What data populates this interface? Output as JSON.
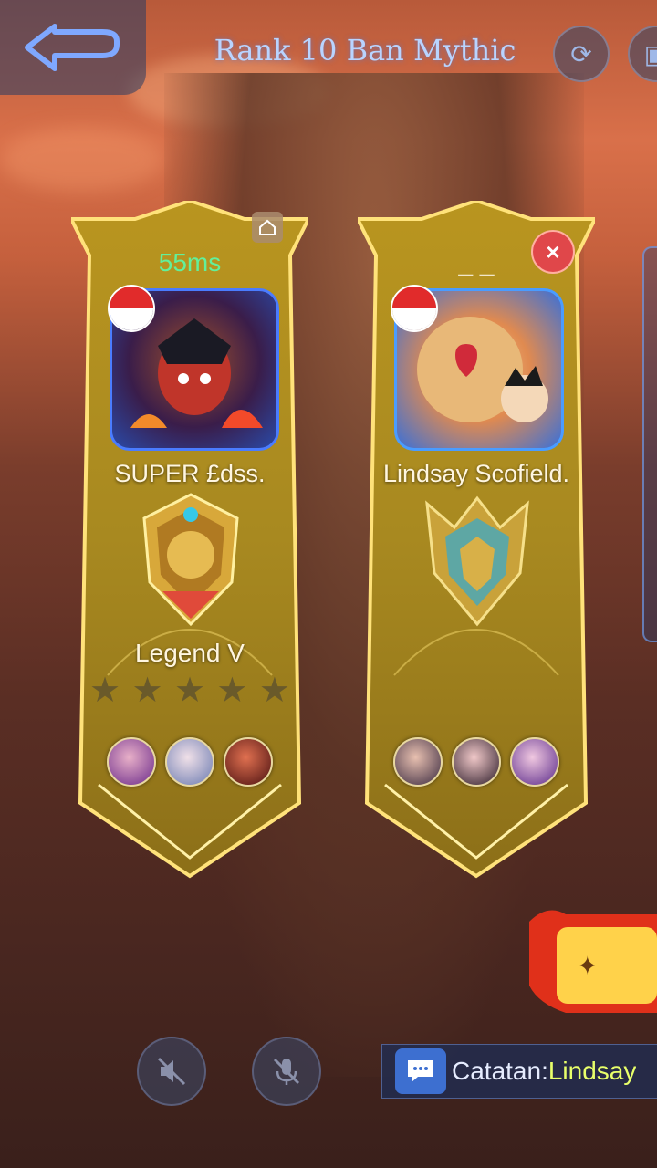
{
  "header": {
    "title": "Rank 10 Ban Mythic"
  },
  "players": [
    {
      "ping": "55ms",
      "name": "SUPER £dss.",
      "rank": "Legend V",
      "stars_filled": 0,
      "stars_total": 5,
      "flag": "Indonesia",
      "heroes": [
        "hero-1-icon",
        "hero-2-icon",
        "hero-3-icon"
      ]
    },
    {
      "ping": "_ _",
      "name": "Lindsay Scofield.",
      "rank": "",
      "flag": "Indonesia",
      "heroes": [
        "hero-4-icon",
        "hero-5-icon",
        "hero-6-icon"
      ]
    }
  ],
  "chat": {
    "prefix": "Catatan:",
    "name": "Lindsay"
  },
  "colors": {
    "ping_good": "#62f09a",
    "gold": "#d9b53a",
    "chat_name": "#e8ff6a"
  }
}
